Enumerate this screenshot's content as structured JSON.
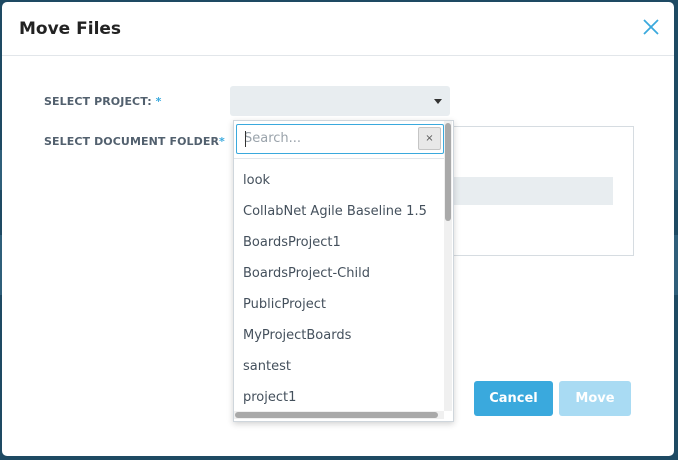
{
  "modal": {
    "title": "Move Files",
    "close_icon": "close-x-icon"
  },
  "form": {
    "project_label": "SELECT PROJECT:",
    "project_required": " *",
    "folder_label": "SELECT DOCUMENT FOLDER",
    "folder_required": "*",
    "project_selected": ""
  },
  "dropdown": {
    "search_placeholder": "Search...",
    "clear_label": "×",
    "items": [
      "look",
      "CollabNet Agile Baseline 1.5",
      "BoardsProject1",
      "BoardsProject-Child",
      "PublicProject",
      "MyProjectBoards",
      "santest",
      "project1"
    ]
  },
  "buttons": {
    "cancel": "Cancel",
    "move": "Move"
  },
  "colors": {
    "accent": "#3aa9dd",
    "accent_disabled": "#a9dbf3"
  }
}
